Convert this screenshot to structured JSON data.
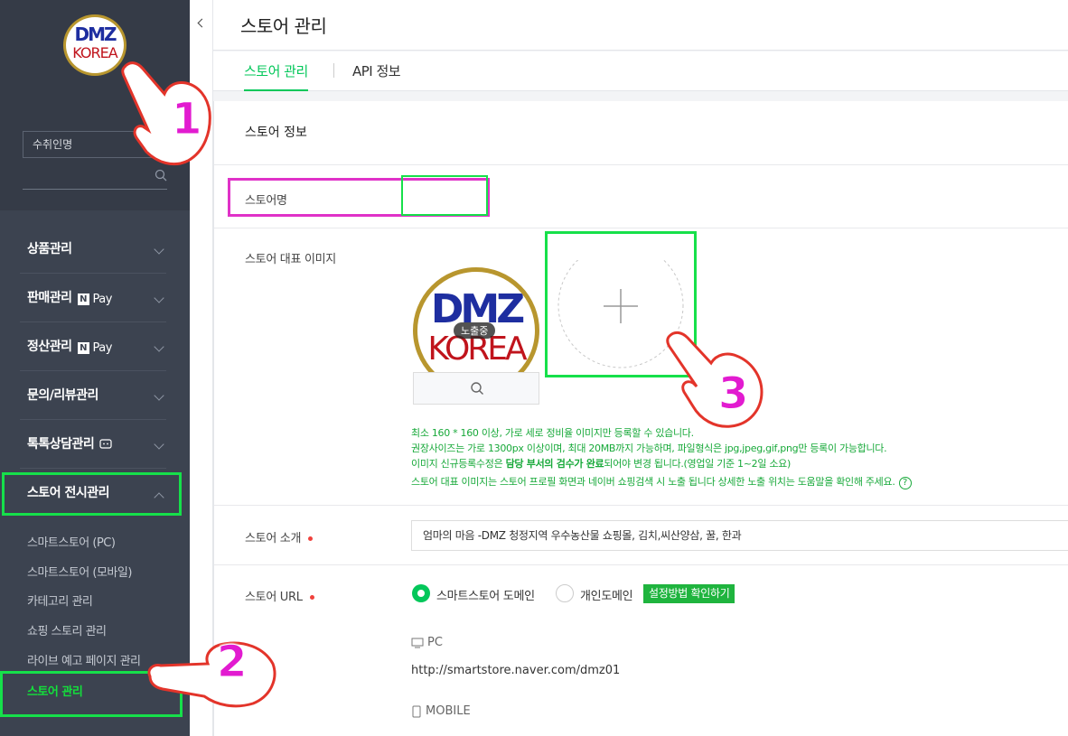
{
  "sidebar": {
    "logo": {
      "line1": "DMZ",
      "line2": "KOREA"
    },
    "seller_name": "수취인명",
    "menus": [
      {
        "label": "상품관리"
      },
      {
        "label": "판매관리",
        "badge": "Pay"
      },
      {
        "label": "정산관리",
        "badge": "Pay"
      },
      {
        "label": "문의/리뷰관리"
      },
      {
        "label": "톡톡상담관리"
      },
      {
        "label": "스토어 전시관리"
      }
    ],
    "npay_letter": "N",
    "submenu": [
      "스마트스토어 (PC)",
      "스마트스토어 (모바일)",
      "카테고리 관리",
      "쇼핑 스토리 관리",
      "라이브 예고 페이지 관리",
      "스토어 관리"
    ]
  },
  "header": {
    "title": "스토어 관리"
  },
  "tabs": [
    {
      "label": "스토어 관리",
      "active": true
    },
    {
      "label": "API 정보",
      "active": false
    }
  ],
  "section": {
    "title": "스토어 정보"
  },
  "fields": {
    "store_name_label": "스토어명",
    "store_image_label": "스토어 대표 이미지",
    "exposed_badge": "노출중",
    "image_text": {
      "line1": "DMZ",
      "line2": "KOREA"
    },
    "guide": {
      "line1": "최소 160 * 160 이상, 가로 세로 정비율 이미지만 등록할 수 있습니다.",
      "line2": "권장사이즈는 가로 1300px 이상이며, 최대 20MB까지 가능하며, 파일형식은 jpg,jpeg,gif,png만 등록이 가능합니다.",
      "line3_pre": "이미지 신규등록수정은 ",
      "line3_bold": "담당 부서의 검수가 완료",
      "line3_post": "되어야 변경 됩니다.(영업일 기준 1~2일 소요)",
      "line4": "스토어 대표 이미지는 스토어 프로필 화면과 네이버 쇼핑검색 시 노출 됩니다 상세한 노출 위치는 도움말을 확인해 주세요.",
      "help": "?"
    },
    "intro_label": "스토어 소개",
    "intro_value": "엄마의 마음 -DMZ 청정지역 우수농산물 쇼핑몰, 김치,씨산양삼, 꿀, 한과",
    "url_label": "스토어 URL",
    "url_options": [
      "스마트스토어 도메인",
      "개인도메인"
    ],
    "howto_button": "설정방법 확인하기",
    "pc_label": "PC",
    "pc_url": "http://smartstore.naver.com/dmz01",
    "mobile_label": "MOBILE"
  },
  "annotations": {
    "n1": "1",
    "n2": "2",
    "n3": "3"
  },
  "colors": {
    "accent": "#03c75a",
    "highlight_green": "#16e04a",
    "highlight_pink": "#e032c8",
    "sidebar_bg": "#3c4350"
  }
}
